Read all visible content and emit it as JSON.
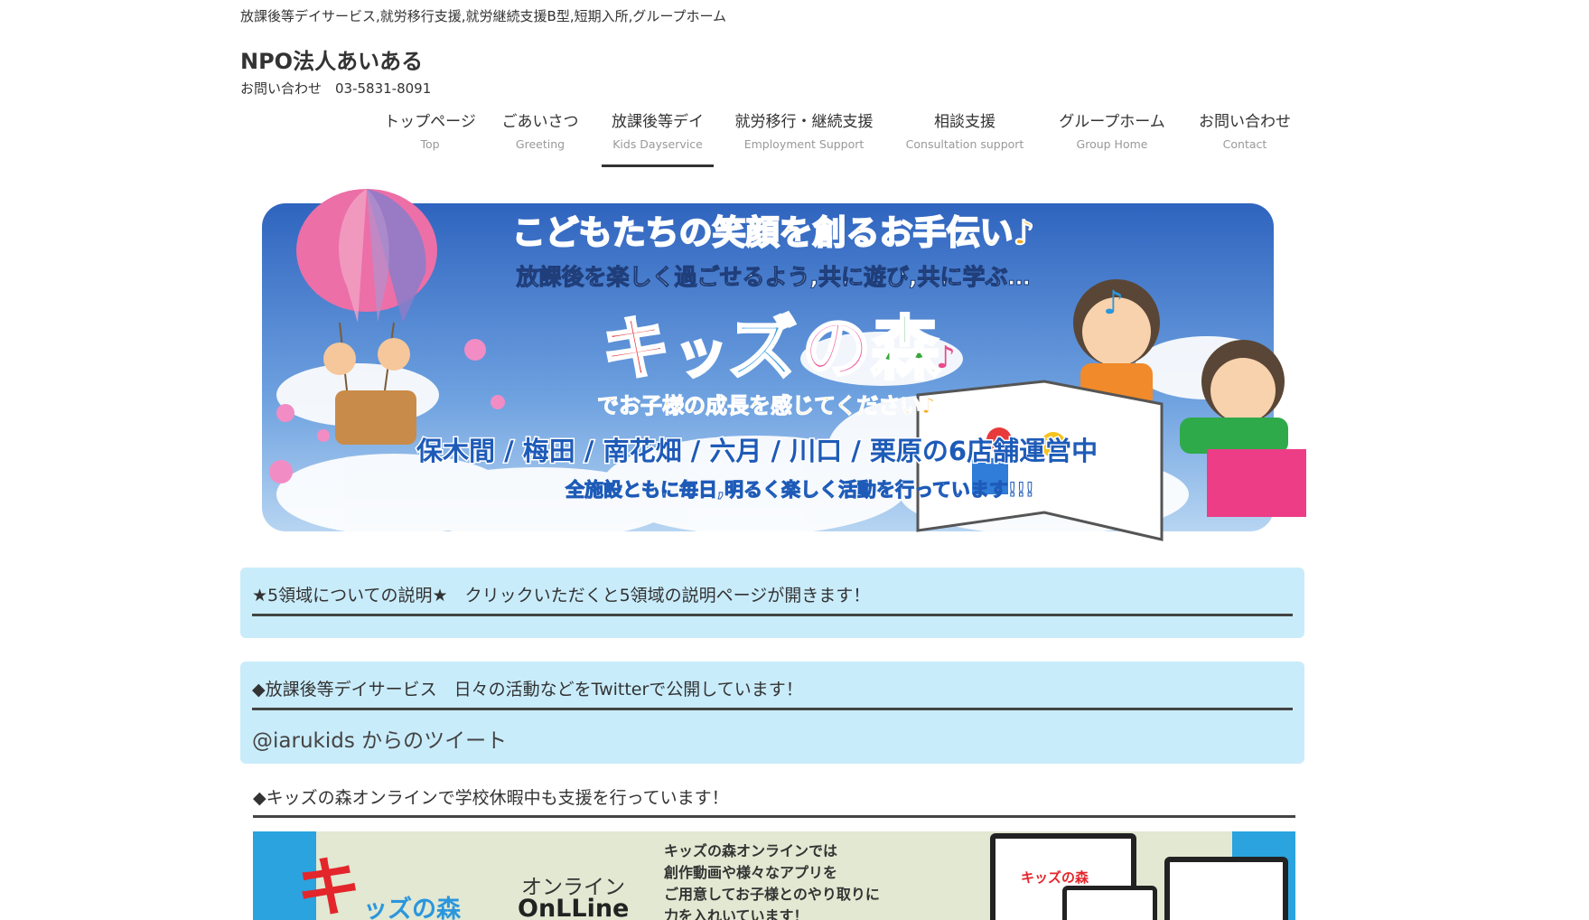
{
  "header": {
    "tagline": "放課後等デイサービス,就労移行支援,就労継続支援B型,短期入所,グループホーム",
    "site_title": "NPO法人あいある",
    "contact": "お問い合わせ　03-5831-8091"
  },
  "nav": [
    {
      "jp": "トップページ",
      "en": "Top"
    },
    {
      "jp": "ごあいさつ",
      "en": "Greeting"
    },
    {
      "jp": "放課後等デイ",
      "en": "Kids Dayservice"
    },
    {
      "jp": "就労移行・継続支援",
      "en": "Employment Support"
    },
    {
      "jp": "相談支援",
      "en": "Consultation support"
    },
    {
      "jp": "グループホーム",
      "en": "Group Home"
    },
    {
      "jp": "お問い合わせ",
      "en": "Contact"
    }
  ],
  "hero": {
    "headline": "こどもたちの笑顔を創るお手伝い♪",
    "subheadline": "放課後を楽しく過ごせるよう,共に遊び,共に学ぶ…",
    "brand_chars": [
      "キ",
      "ッ",
      "ズ",
      "の",
      "森"
    ],
    "tagline": "でお子様の成長を感じてください♪",
    "locations": "保木間 / 梅田 / 南花畑 / 六月 / 川口 / 栗原の6店舗運営中",
    "footer": "全施設ともに毎日,明るく楽しく活動を行っています!!!",
    "colors": {
      "sky": "#3f77cc",
      "orange": "#f7a81b",
      "brand": [
        "#e3262b",
        "#f2c300",
        "#2a96dd",
        "#ec5fa0",
        "#35a93a"
      ]
    }
  },
  "boxes": {
    "five_domains": "★5領域についての説明★　クリックいただくと5領域の説明ページが開きます！",
    "twitter_heading": "◆放課後等デイサービス　日々の活動などをTwitterで公開しています！",
    "twitter_link": "@iarukids からのツイート"
  },
  "online_section": {
    "heading": "◆キッズの森オンラインで学校休暇中も支援を行っています！",
    "brand_k": "キ",
    "brand_rest": "ッズの森",
    "online_jp": "オンライン",
    "online_en": "OnLLine",
    "lines": [
      "キッズの森オンラインでは",
      "創作動画や様々なアプリを",
      "ご用意してお子様とのやり取りに",
      "力を入れいています！"
    ],
    "device_label": "キッズの森"
  }
}
